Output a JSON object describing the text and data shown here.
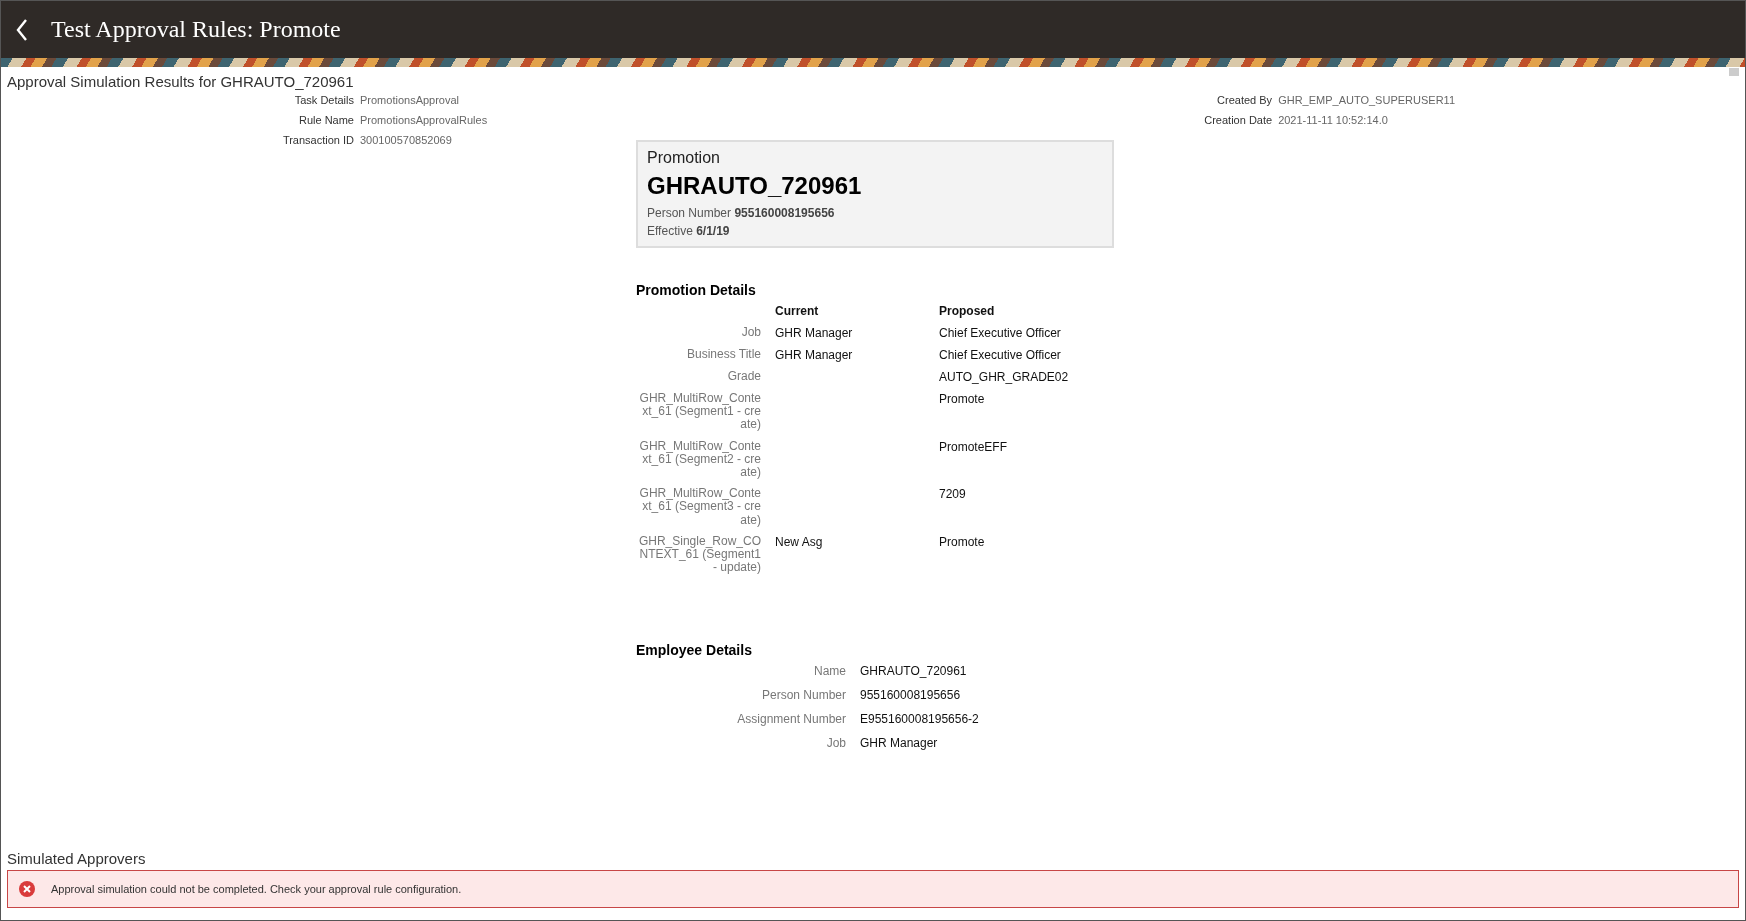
{
  "header": {
    "title": "Test Approval Rules: Promote"
  },
  "subtitle": "Approval Simulation Results for GHRAUTO_720961",
  "task_info": {
    "left": [
      {
        "label": "Task Details",
        "value": "PromotionsApproval"
      },
      {
        "label": "Rule Name",
        "value": "PromotionsApprovalRules"
      },
      {
        "label": "Transaction ID",
        "value": "300100570852069"
      }
    ],
    "right": [
      {
        "label": "Created By",
        "value": "GHR_EMP_AUTO_SUPERUSER11"
      },
      {
        "label": "Creation Date",
        "value": "2021-11-11 10:52:14.0"
      }
    ]
  },
  "card": {
    "type_label": "Promotion",
    "name": "GHRAUTO_720961",
    "person_line": "Person Number **955160008195656**",
    "effective_line": "Effective **6/1/19**"
  },
  "promotion_details": {
    "title": "Promotion Details",
    "columns": [
      "Current",
      "Proposed"
    ],
    "rows": [
      {
        "label": "Job",
        "current": "GHR Manager",
        "proposed": "Chief Executive Officer"
      },
      {
        "label": "Business Title",
        "current": "GHR Manager",
        "proposed": "Chief Executive Officer"
      },
      {
        "label": "Grade",
        "proposed": "AUTO_GHR_GRADE02"
      },
      {
        "label": "GHR_MultiRow_Context_61 (Segment1 - create)",
        "proposed": "Promote"
      },
      {
        "label": "GHR_MultiRow_Context_61 (Segment2 - create)",
        "proposed": "PromoteEFF"
      },
      {
        "label": "GHR_MultiRow_Context_61 (Segment3 - create)",
        "proposed": "7209"
      },
      {
        "label": "GHR_Single_Row_CONTEXT_61 (Segment1 - update)",
        "current": "New Asg",
        "proposed": "Promote"
      }
    ]
  },
  "employee_details": {
    "title": "Employee Details",
    "rows": [
      {
        "label": "Name",
        "value": "GHRAUTO_720961"
      },
      {
        "label": "Person Number",
        "value": "955160008195656"
      },
      {
        "label": "Assignment Number",
        "value": "E955160008195656-2"
      },
      {
        "label": "Job",
        "value": "GHR Manager"
      }
    ]
  },
  "simulated_approvers": {
    "title": "Simulated Approvers",
    "error": "Approval simulation could not be completed. Check your approval rule configuration."
  }
}
